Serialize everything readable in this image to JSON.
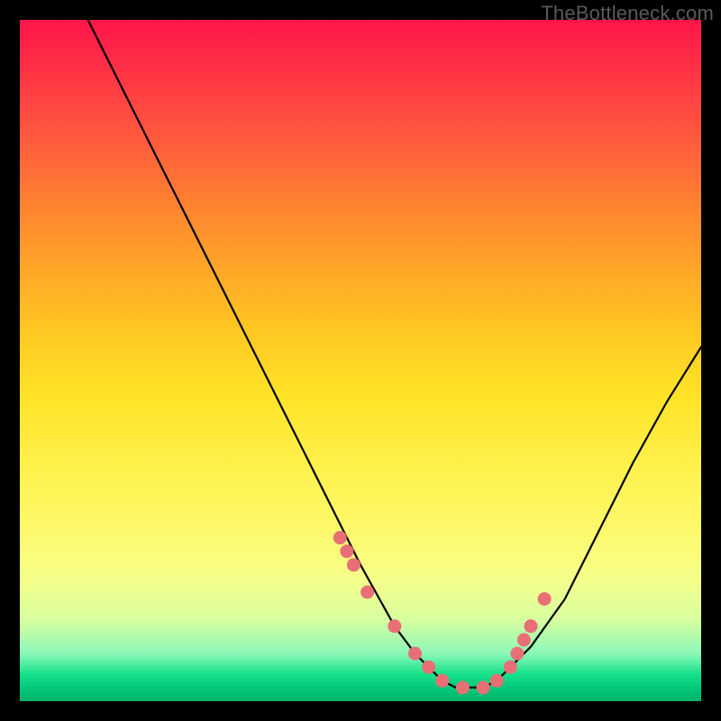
{
  "watermark": "TheBottleneck.com",
  "chart_data": {
    "type": "line",
    "title": "",
    "xlabel": "",
    "ylabel": "",
    "xlim": [
      0,
      100
    ],
    "ylim": [
      0,
      100
    ],
    "series": [
      {
        "name": "bottleneck-curve",
        "x": [
          10,
          15,
          20,
          25,
          30,
          35,
          40,
          45,
          50,
          55,
          58,
          60,
          62,
          64,
          66,
          68,
          70,
          72,
          75,
          80,
          85,
          90,
          95,
          100
        ],
        "values": [
          100,
          90,
          80,
          70,
          60,
          50,
          40,
          30,
          20,
          11,
          7,
          5,
          3,
          2,
          2,
          2,
          3,
          5,
          8,
          15,
          25,
          35,
          44,
          52
        ]
      }
    ],
    "markers": {
      "name": "highlighted-points",
      "color": "#e96f76",
      "x": [
        47,
        48,
        49,
        51,
        55,
        58,
        60,
        62,
        65,
        68,
        70,
        72,
        73,
        74,
        75,
        77
      ],
      "values": [
        24,
        22,
        20,
        16,
        11,
        7,
        5,
        3,
        2,
        2,
        3,
        5,
        7,
        9,
        11,
        15
      ]
    },
    "gradient_stops": [
      {
        "pct": 0,
        "color": "#ff154a"
      },
      {
        "pct": 15,
        "color": "#ff5040"
      },
      {
        "pct": 30,
        "color": "#ff8e2e"
      },
      {
        "pct": 45,
        "color": "#ffc522"
      },
      {
        "pct": 55,
        "color": "#ffe327"
      },
      {
        "pct": 65,
        "color": "#fff04a"
      },
      {
        "pct": 75,
        "color": "#fcf96b"
      },
      {
        "pct": 82,
        "color": "#f6ff8a"
      },
      {
        "pct": 88,
        "color": "#d8ffa0"
      },
      {
        "pct": 93,
        "color": "#8cf8b8"
      },
      {
        "pct": 96,
        "color": "#17e28a"
      },
      {
        "pct": 98,
        "color": "#04c97a"
      },
      {
        "pct": 100,
        "color": "#00b36d"
      }
    ]
  }
}
